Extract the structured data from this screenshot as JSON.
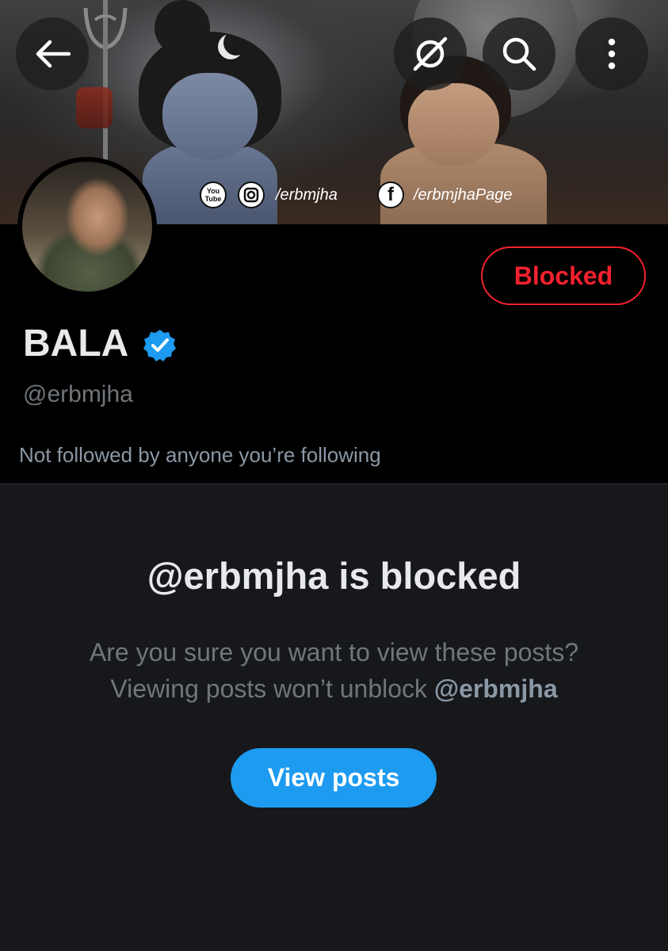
{
  "banner": {
    "social": {
      "youtube_icon_text": "You Tube",
      "instagram_handle": "/erbmjha",
      "facebook_icon_text": "f",
      "facebook_handle": "/erbmjhaPage"
    }
  },
  "toolbar": {
    "back_icon": "arrow-left-icon",
    "grok_icon": "slashed-circle-icon",
    "search_icon": "search-icon",
    "more_icon": "more-vertical-icon"
  },
  "profile": {
    "display_name": "BALA",
    "handle": "@erbmjha",
    "followed_by": "Not followed by anyone you’re following",
    "blocked_label": "Blocked",
    "verified_color": "#1d9bf0"
  },
  "blocked_panel": {
    "title": "@erbmjha is blocked",
    "message_line1": "Are you sure you want to view these posts?",
    "message_line2_prefix": "Viewing posts won’t unblock ",
    "message_line2_handle": "@erbmjha",
    "view_button": "View posts"
  },
  "colors": {
    "accent": "#1d9bf0",
    "danger": "#f4212e",
    "background": "#000000",
    "panel": "#16181c"
  }
}
